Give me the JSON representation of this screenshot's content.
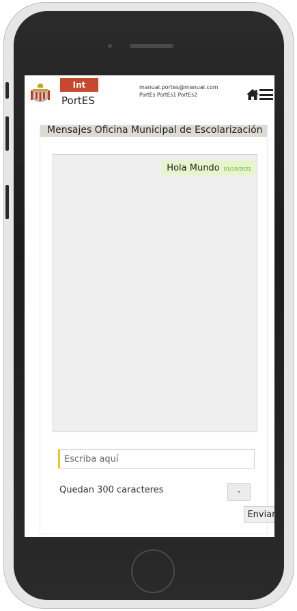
{
  "header": {
    "badge": "Int",
    "app_name": "PortES",
    "user_email": "manual.portes@manual.com",
    "user_names": "PortEs PortEs1 PortEs2"
  },
  "panel": {
    "title": "Mensajes Oficina Municipal de Escolarización"
  },
  "messages": [
    {
      "text": "Hola Mundo",
      "date": "01/10/2021"
    }
  ],
  "composer": {
    "placeholder": "Escriba aquí",
    "remaining_text": "Quedan 300 caracteres",
    "send_label": "Enviar"
  },
  "colors": {
    "badge_bg": "#c8472f",
    "message_bg": "#e6f5cc",
    "message_date": "#5aaa2a",
    "input_accent": "#f0c419"
  },
  "icons": {
    "home": "home-icon",
    "menu": "hamburger-menu-icon",
    "logo": "coat-of-arms-logo"
  }
}
